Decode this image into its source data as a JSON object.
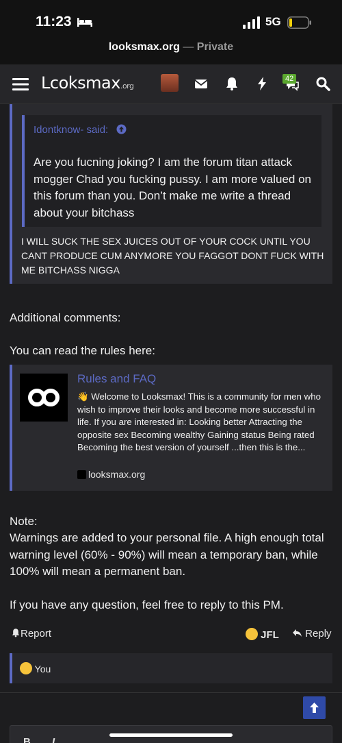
{
  "status": {
    "time": "11:23",
    "network": "5G"
  },
  "browser": {
    "domain": "looksmax.org",
    "separator": "—",
    "mode": "Private"
  },
  "header": {
    "logo": "Lcoksmax",
    "logo_suffix": ".org",
    "notification_count": "42"
  },
  "quote": {
    "inner_author": "Idontknow- said:",
    "inner_text": "Are you fucning joking? I am the forum titan attack mogger Chad you fucking pussy. I am more valued on this forum than you. Don’t make me write a thread about your bitchass",
    "outer_text": "I WILL SUCK THE SEX JUICES OUT OF YOUR COCK UNTIL YOU CANT PRODUCE CUM ANYMORE YOU FAGGOT DONT FUCK WITH ME BITCHASS NIGGA"
  },
  "body": {
    "additional": "Additional comments:",
    "rules_intro": "You can read the rules here:",
    "note_title": "Note:",
    "note_text": "Warnings are added to your personal file. A high enough total warning level (60% - 90%) will mean a temporary ban, while 100% will mean a permanent ban.",
    "closing": "If you have any question, feel free to reply to this PM."
  },
  "unfurl": {
    "title": "Rules and FAQ",
    "description": "👋 Welcome to Looksmax! This is a community for men who wish to improve their looks and become more successful in life. If you are interested in: Looking better Attracting the opposite sex Becoming wealthy Gaining status Being rated Becoming the best version of yourself ...then this is the...",
    "site": "looksmax.org"
  },
  "actions": {
    "report": "Report",
    "jfl": "JFL",
    "reply": "Reply"
  },
  "reactions": {
    "label": "You"
  },
  "editor": {
    "bold": "B",
    "italic": "I"
  },
  "colors": {
    "accent": "#5c6ac4",
    "background": "#1d1d1f",
    "scroll_button": "#2f4aa8"
  }
}
